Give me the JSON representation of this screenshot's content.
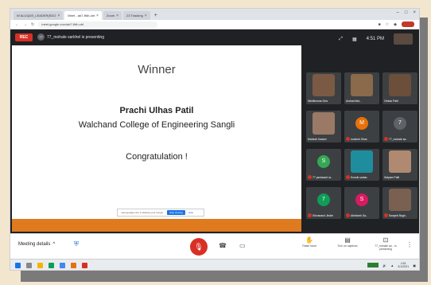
{
  "browser": {
    "tabs": [
      {
        "label": "W ALUQUE_LEADER(SDO",
        "active": false
      },
      {
        "label": "Meet - ab7-ffdh-cbt",
        "active": true
      },
      {
        "label": "Zoom",
        "active": false
      },
      {
        "label": "23 Tracking",
        "active": false
      }
    ],
    "new_tab": "+",
    "url": "meet.google.com/ab7-ffdh-cbt"
  },
  "meet": {
    "rec_label": "REC",
    "presenter_initial": "77",
    "presenter_text": "77_mohale sarkhel is presenting",
    "time": "4:51 PM"
  },
  "slide": {
    "title": "Winner",
    "name": "Prachi Ulhas Patil",
    "college": "Walchand College of Engineering Sangli",
    "message": "Congratulation !",
    "share_notice": "meet.google.com is sharing your screen.",
    "share_stop": "Stop sharing",
    "share_hide": "Hide"
  },
  "participants": [
    {
      "name": "Nikhilkumar Dha",
      "avatar": "",
      "color": "#7a5a44",
      "photo": true,
      "muted": false
    },
    {
      "name": "Arshad Mul..",
      "avatar": "",
      "color": "#8a6a4a",
      "photo": true,
      "muted": false
    },
    {
      "name": "Omkar Patil",
      "avatar": "",
      "color": "#6b4f3a",
      "photo": true,
      "muted": false
    },
    {
      "name": "Mahesh Kadam",
      "avatar": "",
      "color": "#9a7a66",
      "photo": true,
      "muted": false
    },
    {
      "name": "mukesh Dhas",
      "avatar": "M",
      "color": "#e8710a",
      "photo": false,
      "muted": true
    },
    {
      "name": "77_mohale sa..",
      "avatar": "7",
      "color": "#5f6368",
      "photo": false,
      "muted": true
    },
    {
      "name": "77 yashwant ra..",
      "avatar": "S",
      "color": "#34a853",
      "photo": false,
      "muted": true
    },
    {
      "name": "Kousik sarkar..",
      "avatar": "",
      "color": "#1e8e9e",
      "photo": true,
      "muted": true
    },
    {
      "name": "Satyam Patil",
      "avatar": "",
      "color": "#b08a70",
      "photo": true,
      "muted": false
    },
    {
      "name": "Shivanand Jindle",
      "avatar": "7",
      "color": "#0f9d58",
      "photo": false,
      "muted": true
    },
    {
      "name": "Abhishek Sa..",
      "avatar": "S",
      "color": "#d81b60",
      "photo": false,
      "muted": true
    },
    {
      "name": "Swapnil Bagh..",
      "avatar": "",
      "color": "#7a6050",
      "photo": true,
      "muted": true
    }
  ],
  "controls": {
    "meeting_details": "Meeting details",
    "caret": "^",
    "raise_hand": "Raise hand",
    "turn_on_captions": "Turn on captions",
    "presenting": "77_mohale sa... is presenting",
    "more": "⋮"
  },
  "taskbar": {
    "time": "4:51",
    "date": "2/1/2021"
  },
  "colors": {
    "end_call": "#d93025",
    "rec": "#d93025",
    "slide_band": "#e07a1f",
    "meet_bg": "#202124"
  }
}
